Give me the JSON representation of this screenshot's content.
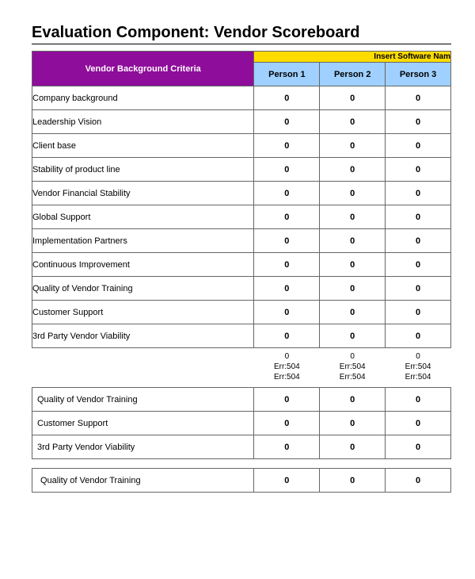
{
  "title": "Evaluation Component: Vendor Scoreboard",
  "header": {
    "criteria_label": "Vendor Background Criteria",
    "software_label": "Insert Software Nam",
    "persons": [
      "Person 1",
      "Person 2",
      "Person 3"
    ]
  },
  "rows1": [
    {
      "label": "Company background",
      "v": [
        "0",
        "0",
        "0"
      ]
    },
    {
      "label": "Leadership Vision",
      "v": [
        "0",
        "0",
        "0"
      ]
    },
    {
      "label": "Client base",
      "v": [
        "0",
        "0",
        "0"
      ]
    },
    {
      "label": "Stability of product line",
      "v": [
        "0",
        "0",
        "0"
      ]
    },
    {
      "label": "Vendor Financial Stability",
      "v": [
        "0",
        "0",
        "0"
      ]
    },
    {
      "label": "Global Support",
      "v": [
        "0",
        "0",
        "0"
      ]
    },
    {
      "label": "Implementation Partners",
      "v": [
        "0",
        "0",
        "0"
      ]
    },
    {
      "label": "Continuous Improvement",
      "v": [
        "0",
        "0",
        "0"
      ]
    },
    {
      "label": "Quality of Vendor Training",
      "v": [
        "0",
        "0",
        "0"
      ]
    },
    {
      "label": "Customer Support",
      "v": [
        "0",
        "0",
        "0"
      ]
    },
    {
      "label": "3rd Party Vendor Viability",
      "v": [
        "0",
        "0",
        "0"
      ]
    }
  ],
  "summary": {
    "line1": [
      "0",
      "0",
      "0"
    ],
    "line2": [
      "Err:504",
      "Err:504",
      "Err:504"
    ],
    "line3": [
      "Err:504",
      "Err:504",
      "Err:504"
    ]
  },
  "rows2": [
    {
      "label": "Quality of Vendor Training",
      "v": [
        "0",
        "0",
        "0"
      ]
    },
    {
      "label": "Customer Support",
      "v": [
        "0",
        "0",
        "0"
      ]
    },
    {
      "label": "3rd Party Vendor Viability",
      "v": [
        "0",
        "0",
        "0"
      ]
    }
  ],
  "rows3": [
    {
      "label": "Quality of Vendor Training",
      "v": [
        "0",
        "0",
        "0"
      ]
    }
  ]
}
